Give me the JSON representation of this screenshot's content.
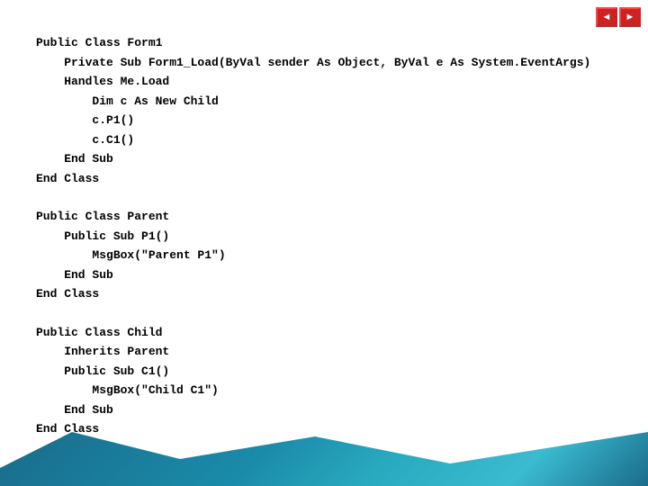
{
  "nav": {
    "back_label": "◄",
    "forward_label": "►"
  },
  "code": {
    "lines": [
      "Public Class Form1",
      "    Private Sub Form1_Load(ByVal sender As Object, ByVal e As System.EventArgs)",
      "    Handles Me.Load",
      "        Dim c As New Child",
      "        c.P1()",
      "        c.C1()",
      "    End Sub",
      "End Class",
      "",
      "Public Class Parent",
      "    Public Sub P1()",
      "        MsgBox(\"Parent P1\")",
      "    End Sub",
      "End Class",
      "",
      "Public Class Child",
      "    Inherits Parent",
      "    Public Sub C1()",
      "        MsgBox(\"Child C1\")",
      "    End Sub",
      "End Class"
    ]
  }
}
